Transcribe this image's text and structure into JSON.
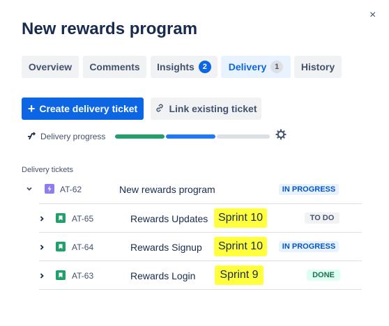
{
  "dialog": {
    "close_label": "×",
    "title": "New rewards program"
  },
  "tabs": [
    {
      "label": "Overview"
    },
    {
      "label": "Comments"
    },
    {
      "label": "Insights",
      "badge": "2"
    },
    {
      "label": "Delivery",
      "badge": "1",
      "active": true
    },
    {
      "label": "History"
    }
  ],
  "actions": {
    "create_label": "Create delivery ticket",
    "link_label": "Link existing ticket"
  },
  "progress": {
    "label": "Delivery progress",
    "done_fraction": 0.33,
    "in_progress_fraction": 0.33,
    "todo_fraction": 0.34
  },
  "tickets": {
    "section_label": "Delivery tickets",
    "parent": {
      "key": "AT-62",
      "summary": "New rewards program",
      "status": "IN PROGRESS",
      "icon": "epic-icon"
    },
    "children": [
      {
        "key": "AT-65",
        "summary": "Rewards Updates",
        "sprint": "Sprint 10",
        "status": "TO DO"
      },
      {
        "key": "AT-64",
        "summary": "Rewards Signup",
        "sprint": "Sprint 10",
        "status": "IN PROGRESS"
      },
      {
        "key": "AT-63",
        "summary": "Rewards Login",
        "sprint": "Sprint 9",
        "status": "DONE"
      }
    ]
  },
  "colors": {
    "primary": "#0c66e4",
    "done": "#22a06b",
    "in_progress": "#1d7afc",
    "todo": "#dcdfe4",
    "highlight": "#ffff3d",
    "epic": "#8f7ee7",
    "story": "#22a06b"
  }
}
